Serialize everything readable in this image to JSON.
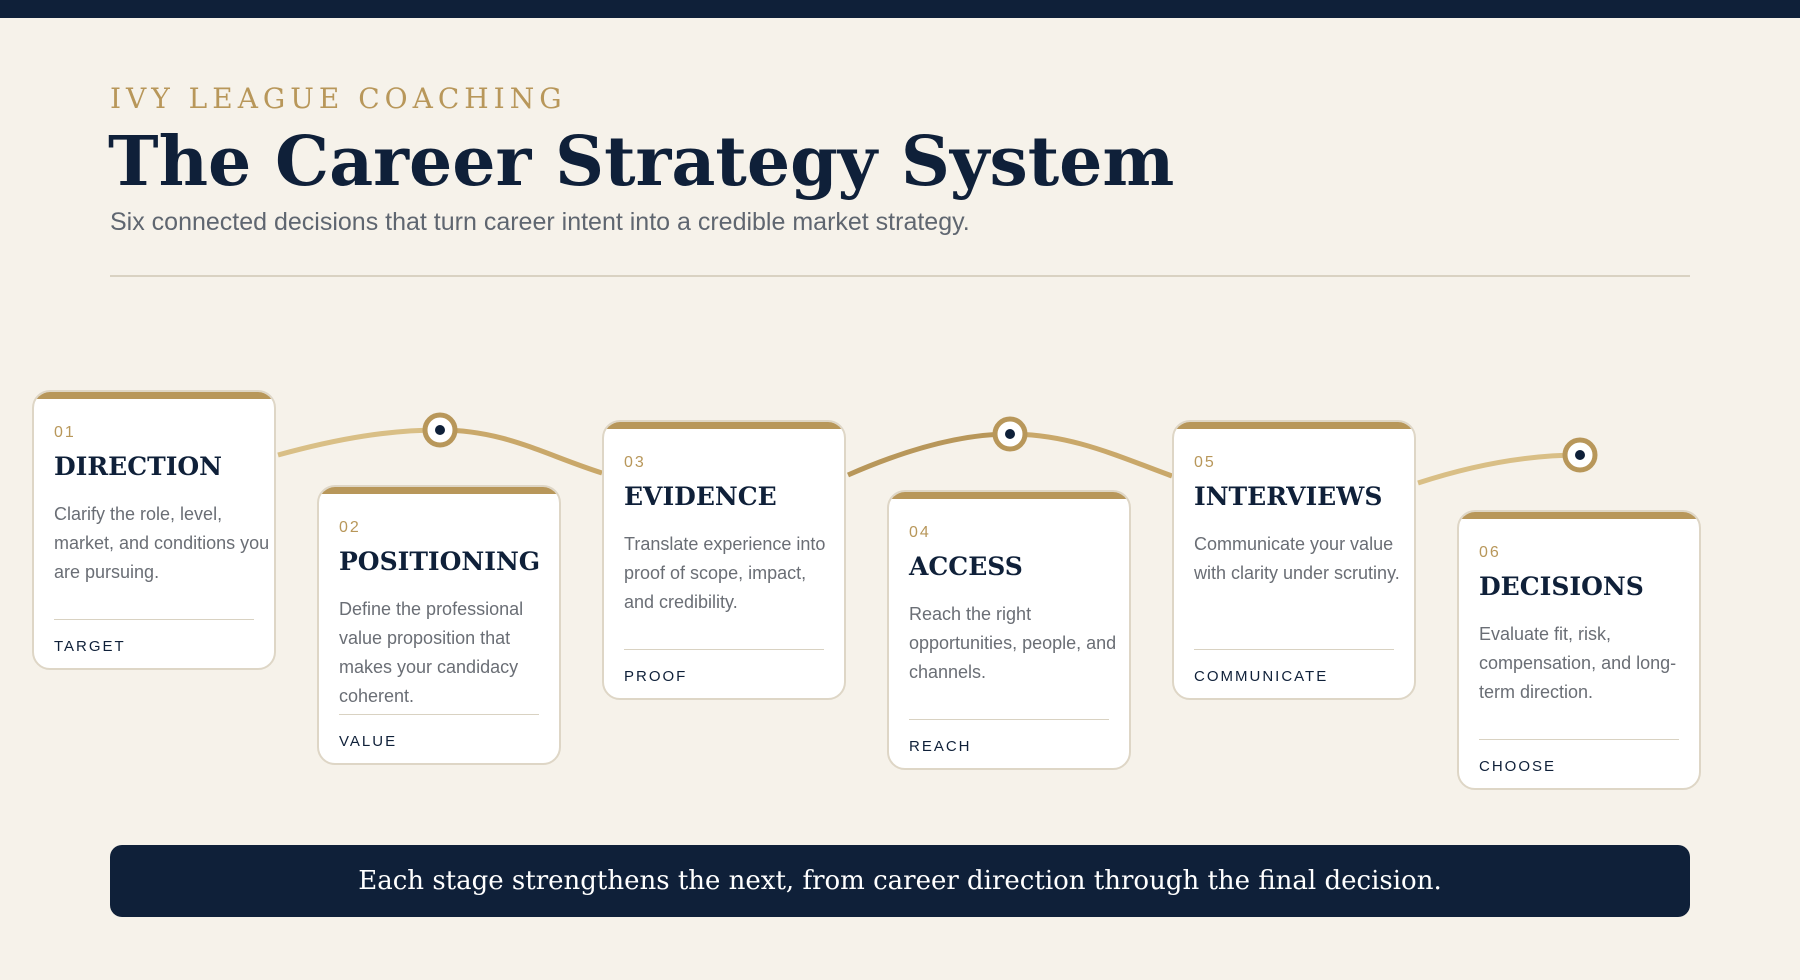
{
  "header": {
    "eyebrow": "IVY LEAGUE COACHING",
    "title": "The Career Strategy System",
    "subtitle": "Six connected decisions that turn career intent into a credible market strategy."
  },
  "stages": [
    {
      "number": "01",
      "title": "DIRECTION",
      "description": "Clarify the role, level, market, and conditions you are pursuing.",
      "tag": "TARGET"
    },
    {
      "number": "02",
      "title": "POSITIONING",
      "description": "Define the professional value proposition that makes your candidacy coherent.",
      "tag": "VALUE"
    },
    {
      "number": "03",
      "title": "EVIDENCE",
      "description": "Translate experience into proof of scope, impact, and credibility.",
      "tag": "PROOF"
    },
    {
      "number": "04",
      "title": "ACCESS",
      "description": "Reach the right opportunities, people, and channels.",
      "tag": "REACH"
    },
    {
      "number": "05",
      "title": "INTERVIEWS",
      "description": "Communicate your value with clarity under scrutiny.",
      "tag": "COMMUNICATE"
    },
    {
      "number": "06",
      "title": "DECISIONS",
      "description": "Evaluate fit, risk, compensation, and long-term direction.",
      "tag": "CHOOSE"
    }
  ],
  "footer": {
    "banner": "Each stage strengthens the next, from career direction through the final decision."
  },
  "colors": {
    "navy": "#0f2039",
    "gold": "#b8975a",
    "gold_light": "#d9bf86",
    "background": "#f6f2ea"
  }
}
